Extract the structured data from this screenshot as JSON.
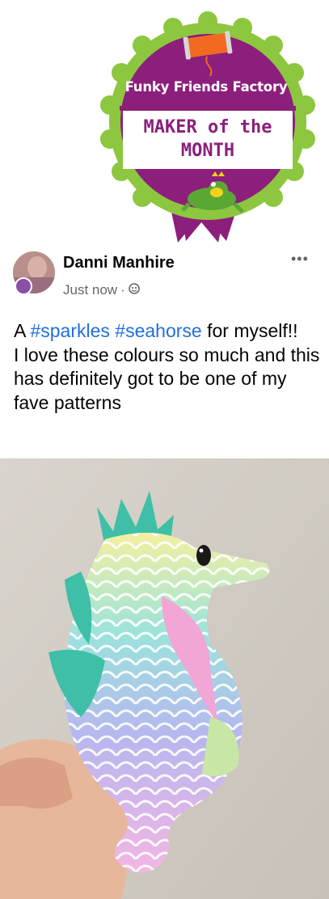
{
  "badge": {
    "brand": "Funky Friends Factory",
    "title_line1": "MAKER of the",
    "title_line2": "MONTH",
    "colors": {
      "purple": "#8c1f7c",
      "green": "#8dc63f",
      "orange": "#f26a21"
    }
  },
  "post": {
    "author": "Danni Manhire",
    "timestamp": "Just now",
    "separator": "·",
    "audience_icon": "friends-icon",
    "more_label": "•••",
    "text": {
      "prefix": "A ",
      "hashtag1": "#sparkles",
      "space": " ",
      "hashtag2": "#seahorse",
      "suffix": " for myself!!",
      "line2": "I love these colours so much and this has definitely got to be one of my fave patterns"
    },
    "link_color": "#216fdb"
  }
}
